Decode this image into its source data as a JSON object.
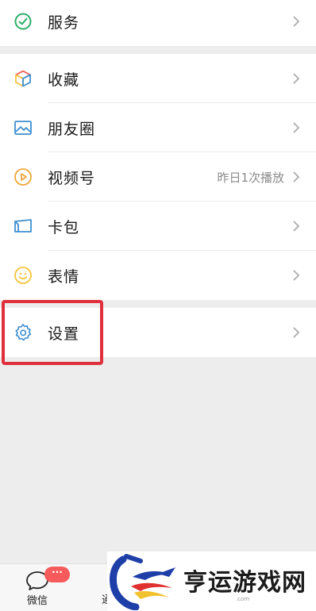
{
  "menu_groups": [
    {
      "items": [
        {
          "label": "服务",
          "value": "",
          "icon": "service-check-icon",
          "icon_color": "#2bae67"
        }
      ]
    },
    {
      "items": [
        {
          "label": "收藏",
          "value": "",
          "icon": "favorites-cube-icon"
        },
        {
          "label": "朋友圈",
          "value": "",
          "icon": "moments-image-icon",
          "icon_color": "#3d8fd1"
        },
        {
          "label": "视频号",
          "value": "昨日1次播放",
          "icon": "channels-play-icon",
          "icon_color": "#f0a63a"
        },
        {
          "label": "卡包",
          "value": "",
          "icon": "card-wallet-icon",
          "icon_color": "#3d8fd1"
        },
        {
          "label": "表情",
          "value": "",
          "icon": "sticker-smile-icon",
          "icon_color": "#f5c43c"
        }
      ]
    },
    {
      "items": [
        {
          "label": "设置",
          "value": "",
          "icon": "settings-gear-icon",
          "icon_color": "#3d8fd1"
        }
      ]
    }
  ],
  "tabbar": {
    "tabs": [
      {
        "label": "微信",
        "icon": "chat-bubble-icon",
        "badge": "···"
      },
      {
        "label": "通"
      }
    ]
  },
  "watermark": {
    "text": "亨运游戏网",
    "domain": ".com"
  },
  "colors": {
    "highlight": "#e0303c",
    "badge": "#f65a5a",
    "background": "#ededed"
  }
}
